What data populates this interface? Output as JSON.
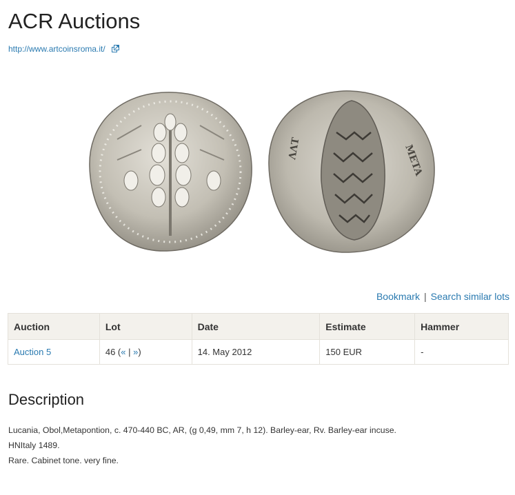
{
  "header": {
    "title": "ACR Auctions",
    "website": "http://www.artcoinsroma.it/"
  },
  "icons": {
    "external_link": "external-link-icon"
  },
  "images": {
    "obverse": "coin-obverse-barley-ear",
    "reverse": "coin-reverse-barley-ear-incuse"
  },
  "actions": {
    "bookmark": "Bookmark",
    "separator": "|",
    "search_similar": "Search similar lots"
  },
  "table": {
    "headers": {
      "auction": "Auction",
      "lot": "Lot",
      "date": "Date",
      "estimate": "Estimate",
      "hammer": "Hammer"
    },
    "row": {
      "auction": "Auction 5",
      "lot_number": "46",
      "lot_open": " (",
      "prev": "«",
      "lot_sep": " | ",
      "next": "»",
      "lot_close": ")",
      "date": "14. May 2012",
      "estimate": "150 EUR",
      "hammer": "-"
    }
  },
  "description": {
    "heading": "Description",
    "line1": "Lucania, Obol,Metapontion, c. 470-440 BC, AR, (g 0,49, mm 7, h 12). Barley-ear, Rv. Barley-ear incuse.",
    "line2": "HNItaly 1489.",
    "line3": "Rare. Cabinet tone. very fine."
  },
  "colors": {
    "link": "#2a7ab0",
    "table_header_bg": "#f3f1ec",
    "table_border": "#e4e1da",
    "coin_silver": "#c9c6bd"
  }
}
